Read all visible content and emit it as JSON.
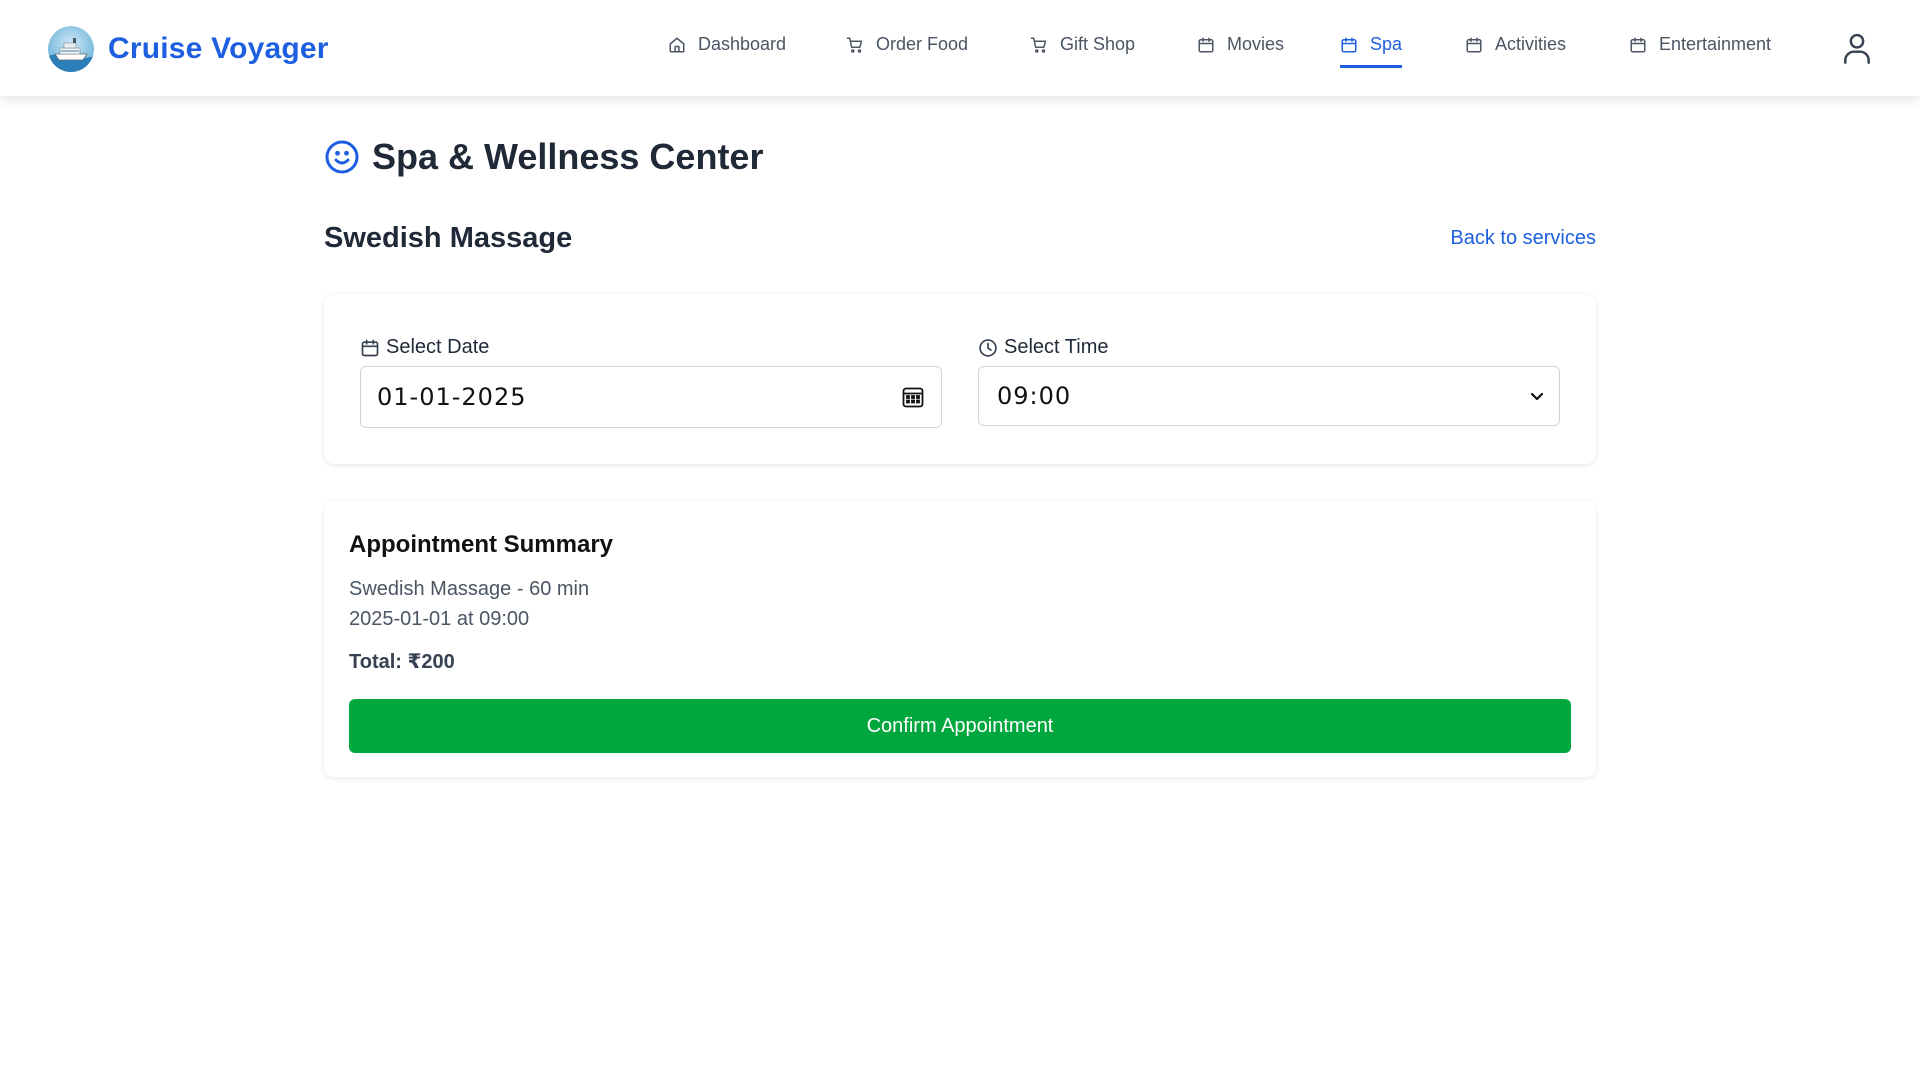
{
  "app": {
    "name": "Cruise Voyager",
    "accent_color": "#1d5fe0",
    "logo_icon": "cruise-ship-icon"
  },
  "nav": {
    "items": [
      {
        "label": "Dashboard",
        "icon": "home-icon"
      },
      {
        "label": "Order Food",
        "icon": "cart-icon"
      },
      {
        "label": "Gift Shop",
        "icon": "cart-icon"
      },
      {
        "label": "Movies",
        "icon": "calendar-icon"
      },
      {
        "label": "Spa",
        "icon": "calendar-icon",
        "active": true
      },
      {
        "label": "Activities",
        "icon": "calendar-icon"
      },
      {
        "label": "Entertainment",
        "icon": "calendar-icon"
      }
    ],
    "user_icon": "user-icon"
  },
  "page": {
    "title": "Spa & Wellness Center",
    "title_icon": "smile-icon"
  },
  "service": {
    "name": "Swedish Massage",
    "back_link": "Back to services"
  },
  "booking": {
    "date_label": "Select Date",
    "date_value": "01-01-2025",
    "time_label": "Select Time",
    "time_value": "09:00"
  },
  "summary": {
    "title": "Appointment Summary",
    "line1": "Swedish Massage - 60 min",
    "line2": "2025-01-01 at 09:00",
    "total": "Total: ₹200",
    "confirm_label": "Confirm Appointment",
    "confirm_color": "#00a63e"
  }
}
